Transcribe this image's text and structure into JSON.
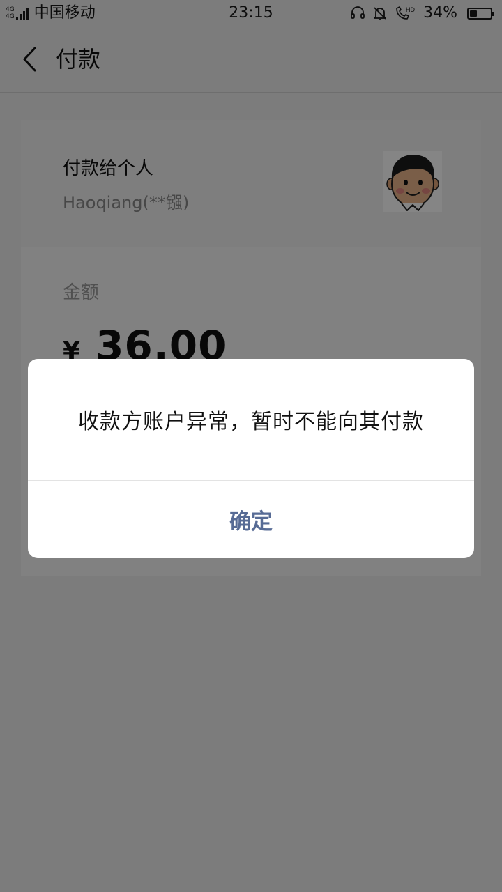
{
  "status_bar": {
    "net_type_top": "4G",
    "net_type_bottom": "4G",
    "carrier": "中国移动",
    "time": "23:15",
    "icons": [
      "headset-icon",
      "bell-off-icon",
      "hd-call-icon"
    ],
    "battery_percent": "34%",
    "battery_level": 0.34
  },
  "nav": {
    "title": "付款",
    "back_icon": "chevron-left-icon"
  },
  "payee": {
    "label": "付款给个人",
    "name": "Haoqiang(**镪)"
  },
  "amount": {
    "label": "金额",
    "currency": "¥",
    "value": "36.00"
  },
  "dialog": {
    "message": "收款方账户异常，暂时不能向其付款",
    "confirm_label": "确定",
    "accent_color": "#576b95"
  }
}
